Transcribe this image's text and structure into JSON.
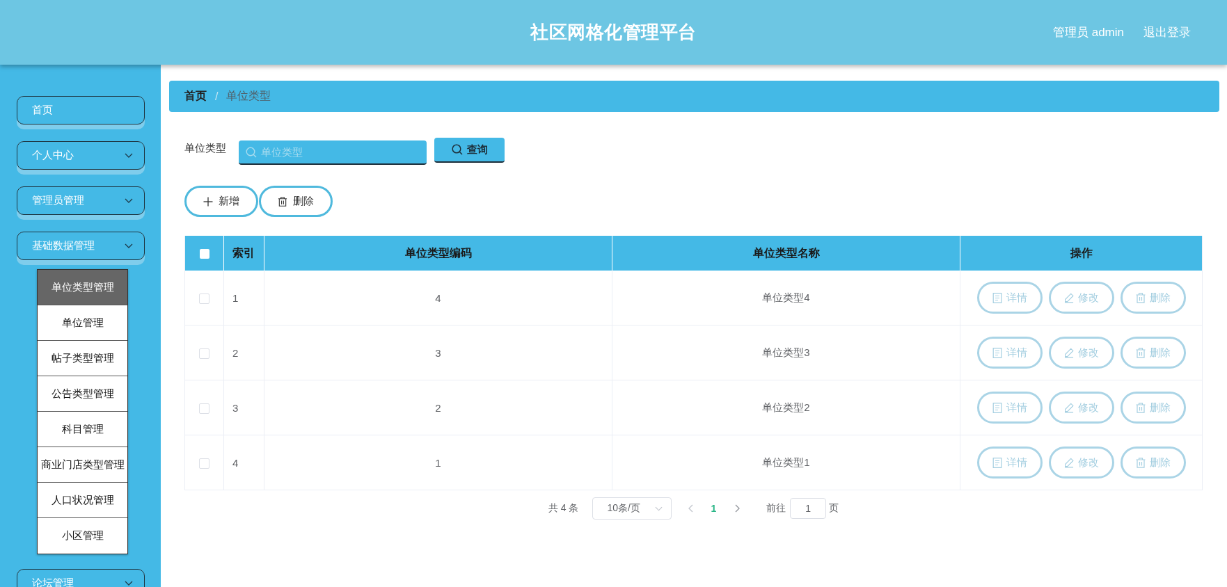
{
  "header": {
    "title": "社区网格化管理平台",
    "user": "管理员 admin",
    "logout": "退出登录"
  },
  "sidebar": {
    "items": [
      {
        "kind": "link",
        "label": "首页"
      },
      {
        "kind": "menu",
        "label": "个人中心"
      },
      {
        "kind": "menu",
        "label": "管理员管理"
      },
      {
        "kind": "menu",
        "label": "基础数据管理",
        "children": [
          {
            "label": "单位类型管理",
            "selected": true
          },
          {
            "label": "单位管理",
            "selected": false
          },
          {
            "label": "帖子类型管理",
            "selected": false
          },
          {
            "label": "公告类型管理",
            "selected": false
          },
          {
            "label": "科目管理",
            "selected": false
          },
          {
            "label": "商业门店类型管理",
            "selected": false
          },
          {
            "label": "人口状况管理",
            "selected": false
          },
          {
            "label": "小区管理",
            "selected": false
          }
        ]
      },
      {
        "kind": "menu",
        "label": "论坛管理"
      }
    ]
  },
  "breadcrumb": {
    "items": [
      "首页",
      "单位类型"
    ],
    "separator": "/"
  },
  "search": {
    "label": "单位类型",
    "placeholder": "单位类型",
    "button": "查询"
  },
  "actions": [
    {
      "kind": "add",
      "label": "新增"
    },
    {
      "kind": "delete",
      "label": "删除"
    }
  ],
  "table": {
    "select_all": {
      "checked": false
    },
    "columns": [
      "索引",
      "单位类型编码",
      "单位类型名称",
      "操作"
    ],
    "rows": [
      {
        "checked": false,
        "index": "1",
        "code": "4",
        "name": "单位类型4",
        "actions": [
          {
            "kind": "detail",
            "label": "详情"
          },
          {
            "kind": "edit",
            "label": "修改"
          },
          {
            "kind": "delete",
            "label": "删除"
          }
        ]
      },
      {
        "checked": false,
        "index": "2",
        "code": "3",
        "name": "单位类型3",
        "actions": [
          {
            "kind": "detail",
            "label": "详情"
          },
          {
            "kind": "edit",
            "label": "修改"
          },
          {
            "kind": "delete",
            "label": "删除"
          }
        ]
      },
      {
        "checked": false,
        "index": "3",
        "code": "2",
        "name": "单位类型2",
        "actions": [
          {
            "kind": "detail",
            "label": "详情"
          },
          {
            "kind": "edit",
            "label": "修改"
          },
          {
            "kind": "delete",
            "label": "删除"
          }
        ]
      },
      {
        "checked": false,
        "index": "4",
        "code": "1",
        "name": "单位类型1",
        "actions": [
          {
            "kind": "detail",
            "label": "详情"
          },
          {
            "kind": "edit",
            "label": "修改"
          },
          {
            "kind": "delete",
            "label": "删除"
          }
        ]
      }
    ]
  },
  "pagination": {
    "total": "共 4 条",
    "page_size": "10条/页",
    "pages": [
      {
        "label": "1",
        "selected": true
      }
    ],
    "goto_label": "前往",
    "goto_value": "1",
    "goto_suffix": "页"
  }
}
